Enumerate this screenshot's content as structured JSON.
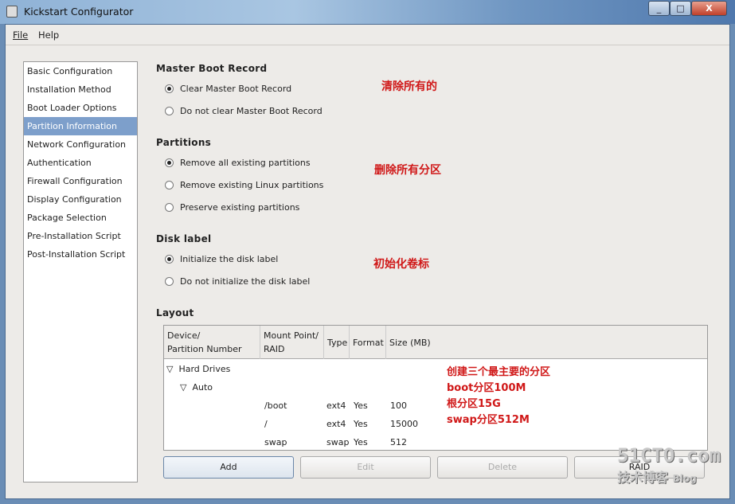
{
  "window": {
    "title": "Kickstart Configurator",
    "minimize": "_",
    "maximize": "□",
    "close": "X"
  },
  "menu": {
    "file": "File",
    "help": "Help"
  },
  "sidebar": {
    "items": [
      {
        "label": "Basic Configuration"
      },
      {
        "label": "Installation Method"
      },
      {
        "label": "Boot Loader Options"
      },
      {
        "label": "Partition Information",
        "selected": true
      },
      {
        "label": "Network Configuration"
      },
      {
        "label": "Authentication"
      },
      {
        "label": "Firewall Configuration"
      },
      {
        "label": "Display Configuration"
      },
      {
        "label": "Package Selection"
      },
      {
        "label": "Pre-Installation Script"
      },
      {
        "label": "Post-Installation Script"
      }
    ]
  },
  "mbr": {
    "heading": "Master Boot Record",
    "options": [
      "Clear Master Boot Record",
      "Do not clear Master Boot Record"
    ],
    "selected": 0,
    "note": "清除所有的"
  },
  "partitions": {
    "heading": "Partitions",
    "options": [
      "Remove all existing partitions",
      "Remove existing Linux partitions",
      "Preserve existing partitions"
    ],
    "selected": 0,
    "note": "删除所有分区"
  },
  "disklabel": {
    "heading": "Disk label",
    "options": [
      "Initialize the disk label",
      "Do not initialize the disk label"
    ],
    "selected": 0,
    "note": "初始化卷标"
  },
  "layout": {
    "heading": "Layout",
    "columns": [
      "Device/\nPartition Number",
      "Mount Point/\nRAID",
      "Type",
      "Format",
      "Size (MB)"
    ],
    "tree": {
      "root": "Hard Drives",
      "child": "Auto"
    },
    "rows": [
      {
        "mount": "/boot",
        "type": "ext4",
        "format": "Yes",
        "size": "100"
      },
      {
        "mount": "/",
        "type": "ext4",
        "format": "Yes",
        "size": "15000"
      },
      {
        "mount": "swap",
        "type": "swap",
        "format": "Yes",
        "size": "512"
      }
    ],
    "notes": [
      "创建三个最主要的分区",
      "boot分区100M",
      "根分区15G",
      "swap分区512M"
    ]
  },
  "buttons": {
    "add": "Add",
    "edit": "Edit",
    "delete": "Delete",
    "raid": "RAID"
  },
  "watermark": {
    "site": "51CTO.com",
    "sub": "技术博客",
    "blog": "Blog"
  }
}
